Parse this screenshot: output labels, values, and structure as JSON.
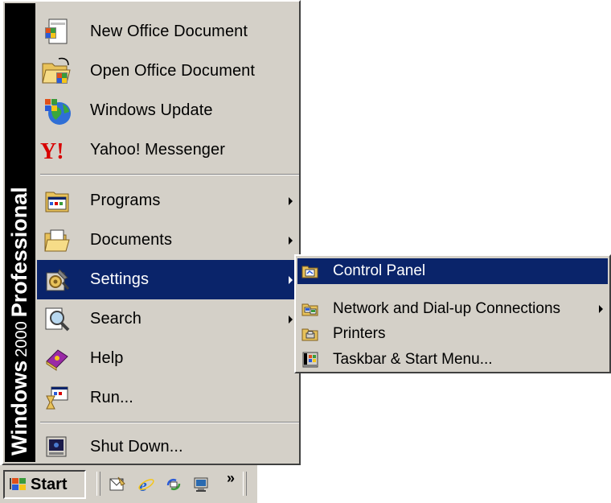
{
  "banner": {
    "brand": "Windows",
    "version": "2000",
    "edition": "Professional"
  },
  "start_menu": {
    "items": [
      {
        "label": "New Office Document",
        "icon": "new-office-document-icon"
      },
      {
        "label": "Open Office Document",
        "icon": "open-office-document-icon"
      },
      {
        "label": "Windows Update",
        "icon": "windows-update-globe-icon"
      },
      {
        "label": "Yahoo! Messenger",
        "icon": "yahoo-logo-icon"
      },
      {
        "label": "Programs",
        "icon": "programs-icon",
        "submenu": true
      },
      {
        "label": "Documents",
        "icon": "documents-folder-icon",
        "submenu": true
      },
      {
        "label": "Settings",
        "icon": "settings-icon",
        "submenu": true,
        "selected": true
      },
      {
        "label": "Search",
        "icon": "search-magnifier-icon",
        "submenu": true
      },
      {
        "label": "Help",
        "icon": "help-book-icon"
      },
      {
        "label": "Run...",
        "icon": "run-icon"
      },
      {
        "label": "Shut Down...",
        "icon": "shut-down-icon"
      }
    ]
  },
  "settings_submenu": {
    "items": [
      {
        "label": "Control Panel",
        "icon": "control-panel-icon",
        "selected": true
      },
      {
        "label": "Network and Dial-up Connections",
        "icon": "network-connections-icon",
        "submenu": true
      },
      {
        "label": "Printers",
        "icon": "printers-folder-icon"
      },
      {
        "label": "Taskbar & Start Menu...",
        "icon": "taskbar-icon"
      }
    ]
  },
  "taskbar": {
    "start_label": "Start",
    "chevron": "»",
    "quick_launch": [
      "outlook-express-icon",
      "internet-explorer-icon",
      "windows-explorer-icon",
      "show-desktop-icon"
    ]
  },
  "colors": {
    "menu_bg": "#d4d0c8",
    "highlight": "#0a246a",
    "banner_bg": "#000000"
  }
}
